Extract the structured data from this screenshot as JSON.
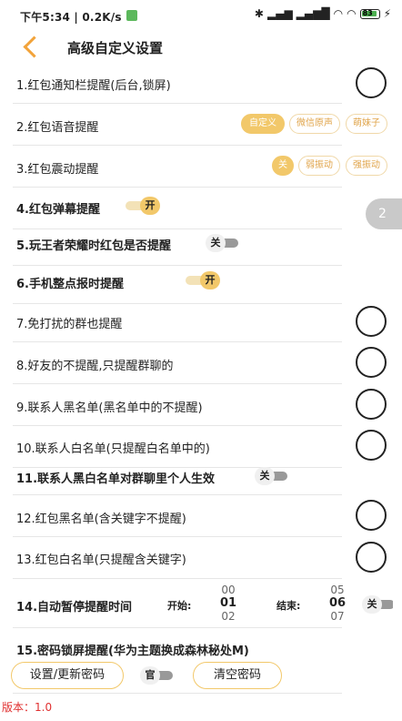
{
  "status_bar": {
    "time": "下午5:34 | 0.2K/s",
    "battery_level": "83",
    "icons": [
      "bluetooth-icon",
      "signal-icon",
      "hd-signal-icon",
      "wifi-icon",
      "battery-icon",
      "charging-icon"
    ]
  },
  "header": {
    "title": "高级自定义设置"
  },
  "settings": {
    "item1": "1.红包通知栏提醒(后台,锁屏)",
    "item2": "2.红包语音提醒",
    "item2_options": [
      "自定义",
      "微信原声",
      "萌妹子"
    ],
    "item2_selected": "自定义",
    "item3": "3.红包震动提醒",
    "item3_options": [
      "关",
      "弱振动",
      "强振动"
    ],
    "item3_selected": "关",
    "item4": "4.红包弹幕提醒",
    "item4_toggle": "开",
    "item5": "5.玩王者荣耀时红包是否提醒",
    "item5_toggle": "关",
    "item6": "6.手机整点报时提醒",
    "item6_toggle": "开",
    "item7": "7.免打扰的群也提醒",
    "item8": "8.好友的不提醒,只提醒群聊的",
    "item9": "9.联系人黑名单(黑名单中的不提醒)",
    "item10": "10.联系人白名单(只提醒白名单中的)",
    "item11": "11.联系人黑白名单对群聊里个人生效",
    "item11_toggle": "关",
    "item12": "12.红包黑名单(含关键字不提醒)",
    "item13": "13.红包白名单(只提醒含关键字)",
    "item14": "14.自动暂停提醒时间",
    "item14_start_label": "开始:",
    "item14_start_values": [
      "00",
      "01",
      "02"
    ],
    "item14_end_label": "结束:",
    "item14_end_values": [
      "05",
      "06",
      "07"
    ],
    "item14_toggle": "关",
    "item15": "15.密码锁屏提醒(华为主题换成森林秘处M)",
    "item15_toggle": "官"
  },
  "buttons": {
    "set_password": "设置/更新密码",
    "clear_password": "清空密码"
  },
  "float_badge": "2",
  "version": "版本：1.0",
  "colors": {
    "accent": "#f2c86a",
    "back_arrow": "#f2a33a",
    "version_text": "#e03030"
  }
}
